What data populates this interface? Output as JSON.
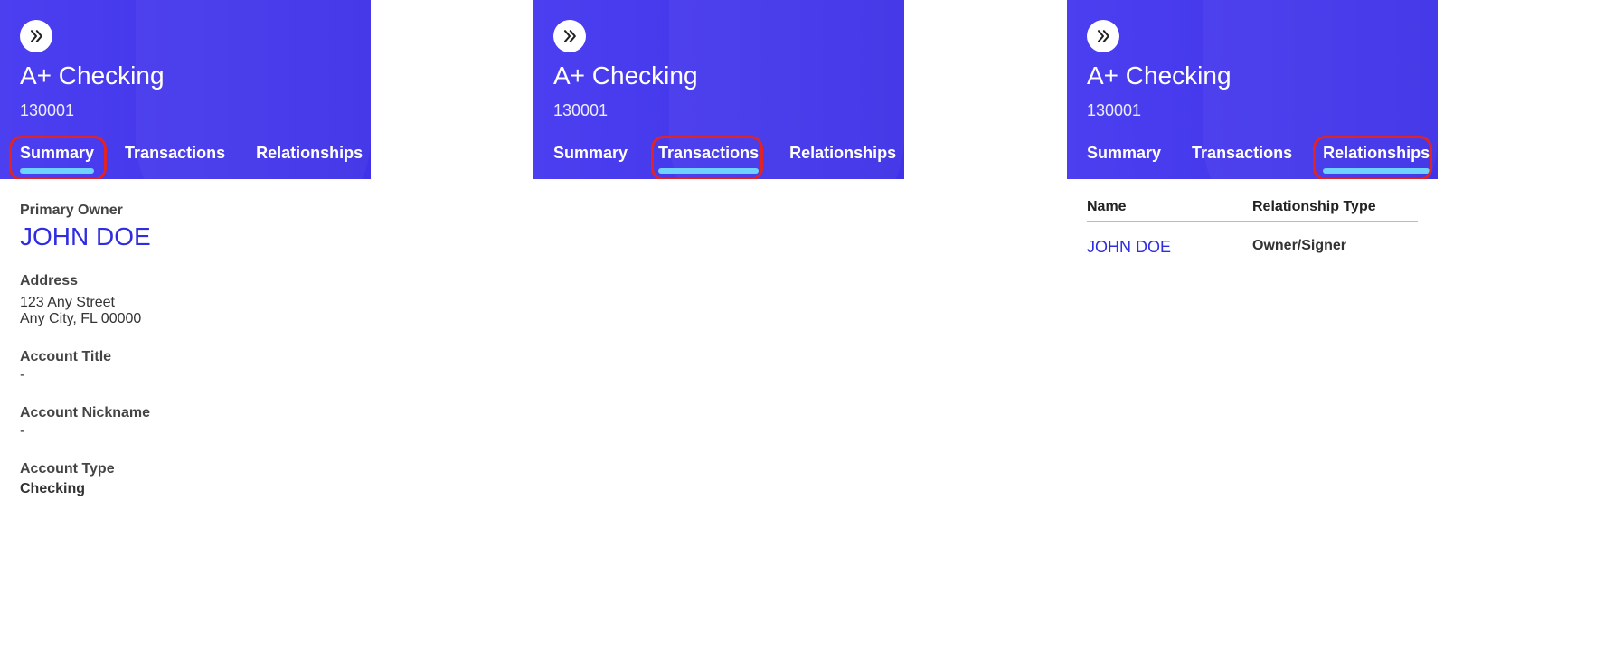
{
  "account": {
    "title": "A+ Checking",
    "number": "130001"
  },
  "tabs": {
    "summary": "Summary",
    "transactions": "Transactions",
    "relationships": "Relationships"
  },
  "summary": {
    "primary_owner_label": "Primary Owner",
    "primary_owner": "JOHN DOE",
    "address_label": "Address",
    "address_line1": "123 Any Street",
    "address_line2": "Any City, FL 00000",
    "account_title_label": "Account Title",
    "account_title": "-",
    "account_nickname_label": "Account Nickname",
    "account_nickname": "-",
    "account_type_label": "Account Type",
    "account_type": "Checking"
  },
  "relationships": {
    "col_name": "Name",
    "col_type": "Relationship Type",
    "rows": [
      {
        "name": "JOHN DOE",
        "type": "Owner/Signer"
      }
    ]
  }
}
